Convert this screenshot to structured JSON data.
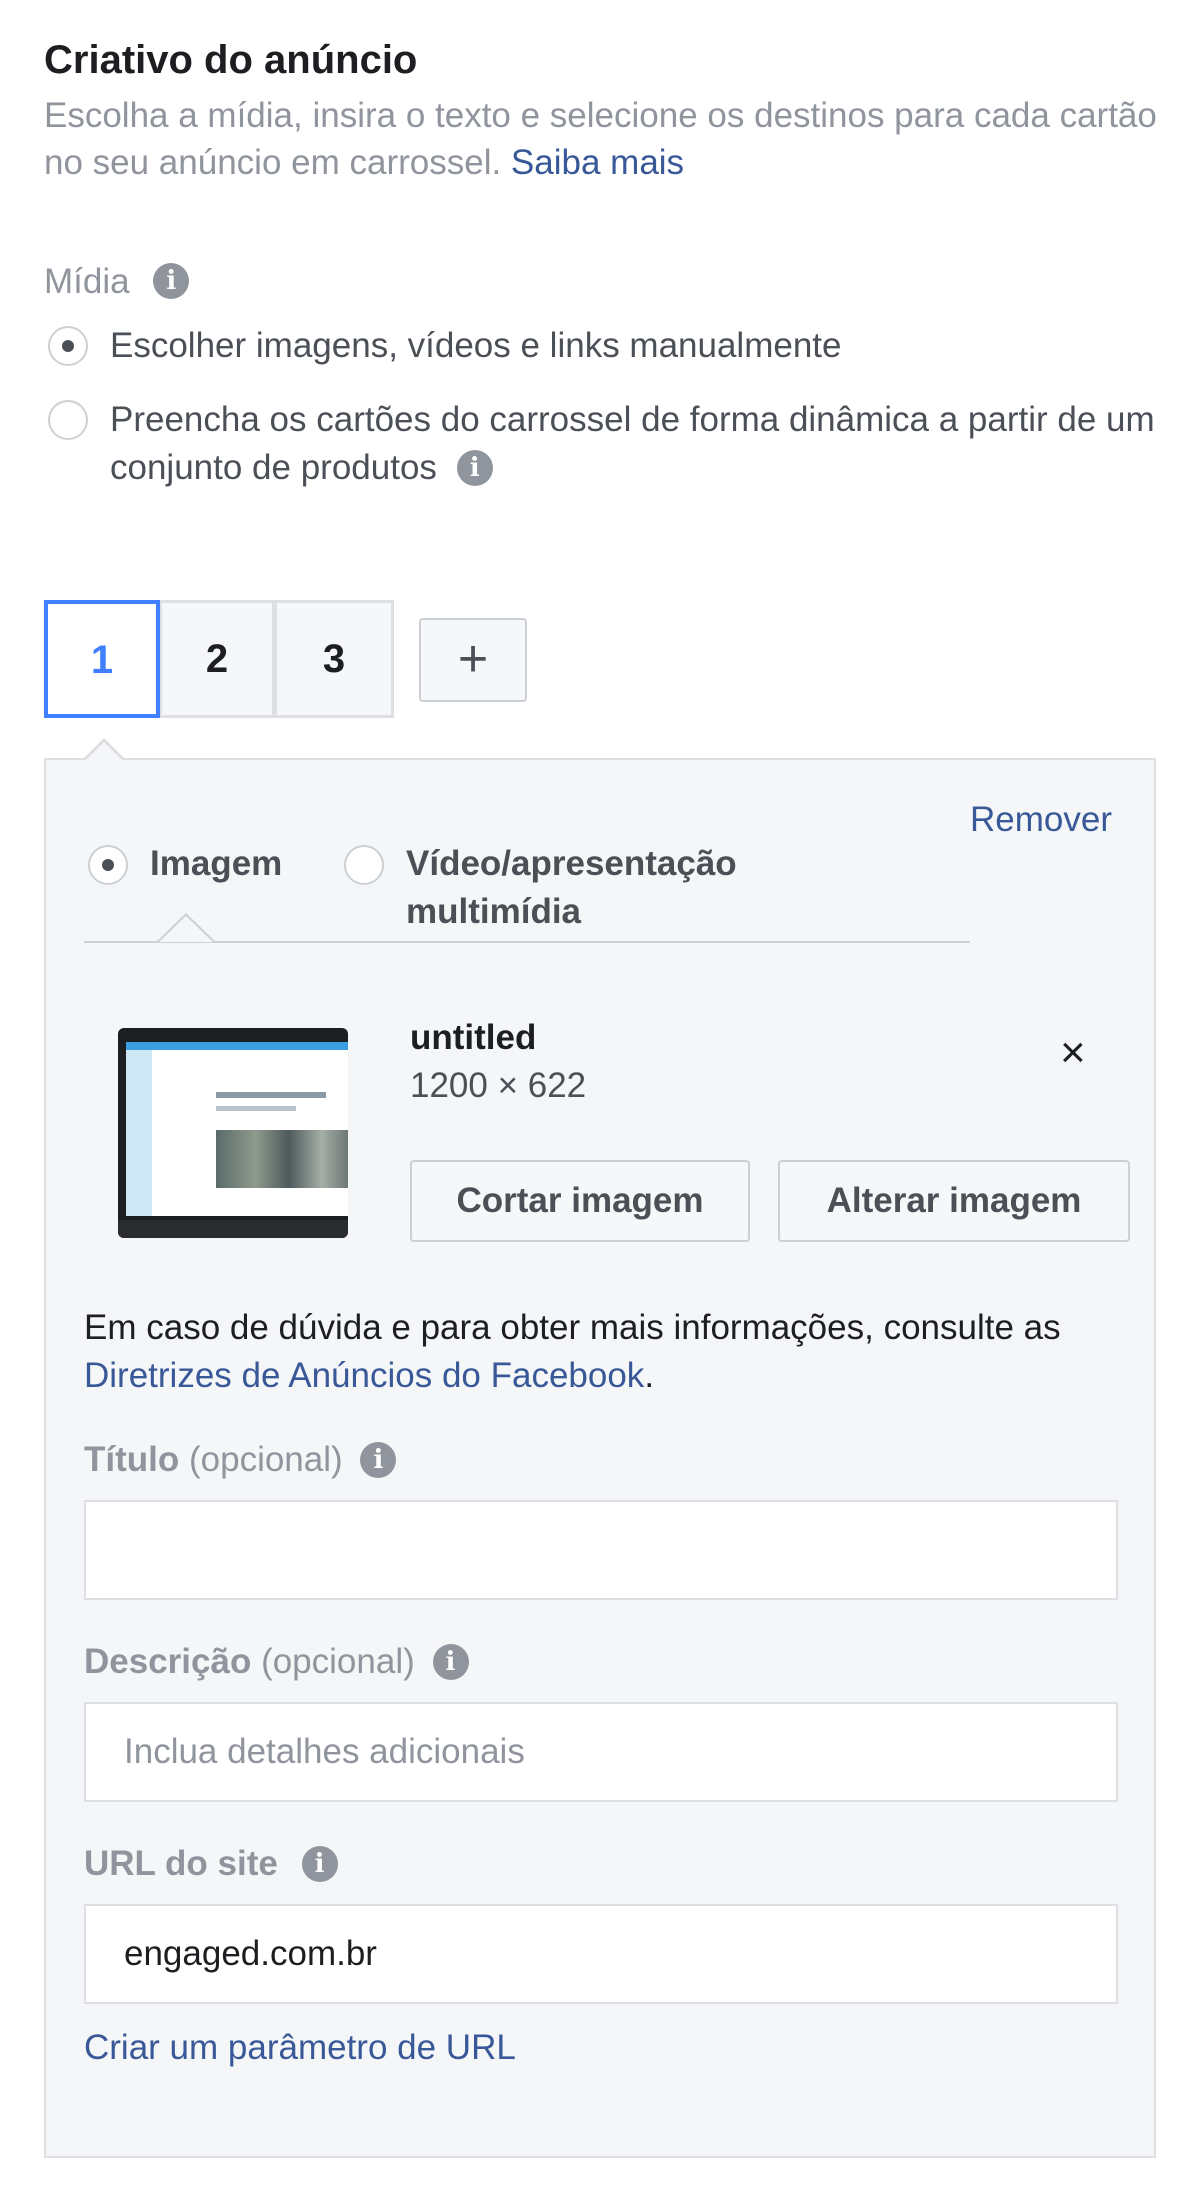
{
  "header": {
    "title": "Criativo do anúncio",
    "description": "Escolha a mídia, insira o texto e selecione os destinos para cada cartão no seu anúncio em carrossel.",
    "learn_more_link": "Saiba mais"
  },
  "media": {
    "label": "Mídia",
    "options": [
      {
        "label": "Escolher imagens, vídeos e links manualmente",
        "selected": true
      },
      {
        "label": "Preencha os cartões do carrossel de forma dinâmica a partir de um conjunto de produtos",
        "selected": false
      }
    ]
  },
  "cards": {
    "tabs": [
      {
        "label": "1",
        "active": true
      },
      {
        "label": "2",
        "active": false
      },
      {
        "label": "3",
        "active": false
      }
    ],
    "add_label": "+",
    "active_card": {
      "remove_link": "Remover",
      "media_types": [
        {
          "label": "Imagem",
          "selected": true
        },
        {
          "label": "Vídeo/apresentação multimídia",
          "selected": false
        }
      ],
      "image": {
        "filename": "untitled",
        "dimensions": "1200 × 622",
        "remove_icon": "×",
        "crop_button": "Cortar imagem",
        "change_button": "Alterar imagem"
      },
      "guidelines": {
        "prefix": "Em caso de dúvida e para obter mais informações, consulte as",
        "link": "Diretrizes de Anúncios do Facebook",
        "suffix": "."
      },
      "fields": {
        "title": {
          "label": "Título",
          "optional": "(opcional)",
          "value": "",
          "placeholder": ""
        },
        "description": {
          "label": "Descrição",
          "optional": "(opcional)",
          "value": "",
          "placeholder": "Inclua detalhes adicionais"
        },
        "url": {
          "label": "URL do site",
          "value": "engaged.com.br"
        }
      },
      "url_param_link": "Criar um parâmetro de URL"
    }
  },
  "icons": {
    "info": "info-icon",
    "info_glyph": "i",
    "close": "close-icon"
  },
  "colors": {
    "link": "#385898",
    "active_tab": "#4080ff",
    "muted_text": "#90949c",
    "panel_bg": "#f5f6f8"
  }
}
